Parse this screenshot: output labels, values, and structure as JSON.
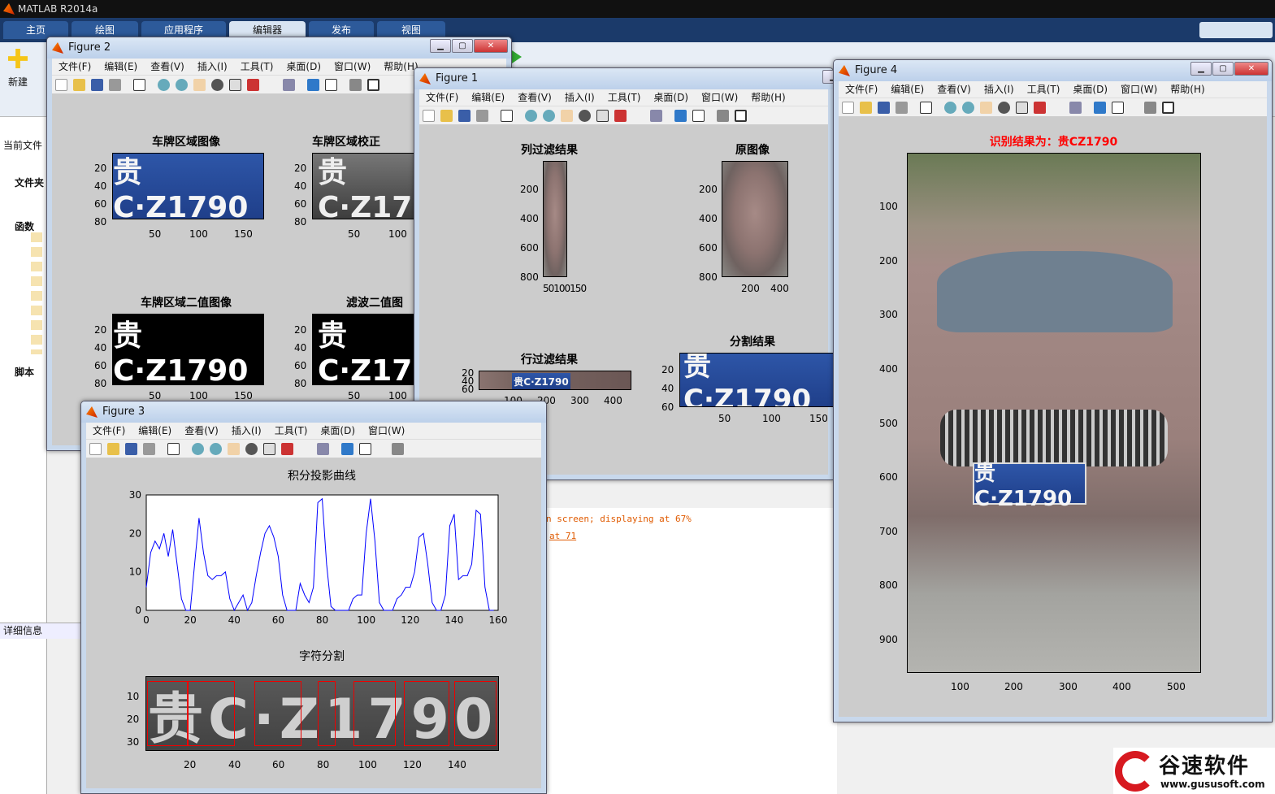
{
  "matlab": {
    "title": "MATLAB R2014a",
    "tabs": [
      "主页",
      "绘图",
      "应用程序",
      "编辑器",
      "发布",
      "视图"
    ],
    "new_label": "新建",
    "current_folder": "当前文件",
    "folder_header": "文件夹",
    "functions_header": "函数",
    "scripts_header": "脚本",
    "details": "详细信息",
    "cmd_lines": [
      "n screen; displaying at 67%",
      "at 71"
    ]
  },
  "menus": [
    "文件(F)",
    "编辑(E)",
    "查看(V)",
    "插入(I)",
    "工具(T)",
    "桌面(D)",
    "窗口(W)",
    "帮助(H)"
  ],
  "fig2": {
    "title": "Figure 2",
    "p1": {
      "title": "车牌区域图像",
      "yticks": [
        "20",
        "40",
        "60",
        "80"
      ],
      "xticks": [
        "50",
        "100",
        "150"
      ]
    },
    "p2": {
      "title": "车牌区域校正",
      "yticks": [
        "20",
        "40",
        "60",
        "80"
      ],
      "xticks": [
        "50",
        "100"
      ]
    },
    "p3": {
      "title": "车牌区域二值图像",
      "yticks": [
        "20",
        "40",
        "60",
        "80"
      ],
      "xticks": [
        "50",
        "100",
        "150"
      ]
    },
    "p4": {
      "title": "滤波二值图",
      "yticks": [
        "20",
        "40",
        "60",
        "80"
      ],
      "xticks": [
        "50",
        "100"
      ]
    }
  },
  "fig1": {
    "title": "Figure 1",
    "p1": {
      "title": "列过滤结果",
      "yticks": [
        "200",
        "400",
        "600",
        "800"
      ],
      "xticks": "50100150"
    },
    "p2": {
      "title": "原图像",
      "yticks": [
        "200",
        "400",
        "600",
        "800"
      ],
      "xticks": [
        "200",
        "400"
      ]
    },
    "p3": {
      "title": "行过滤结果",
      "yticks": [
        "20",
        "40",
        "60"
      ],
      "xticks": [
        "100",
        "200",
        "300",
        "400"
      ]
    },
    "p4": {
      "title": "分割结果",
      "yticks": [
        "20",
        "40",
        "60"
      ],
      "xticks": [
        "50",
        "100",
        "150"
      ]
    }
  },
  "fig3": {
    "title": "Figure 3",
    "chart_title": "积分投影曲线",
    "seg_title": "字符分割",
    "seg_yticks": [
      "10",
      "20",
      "30"
    ],
    "seg_xticks": [
      "20",
      "40",
      "60",
      "80",
      "100",
      "120",
      "140"
    ]
  },
  "fig4": {
    "title": "Figure 4",
    "result": "识别结果为：贵CZ1790",
    "yticks": [
      "100",
      "200",
      "300",
      "400",
      "500",
      "600",
      "700",
      "800",
      "900"
    ],
    "xticks": [
      "100",
      "200",
      "300",
      "400",
      "500"
    ]
  },
  "plate_text": "贵C·Z1790",
  "brand": {
    "name": "谷速软件",
    "url": "www.gususoft.com"
  },
  "chart_data": {
    "type": "line",
    "title": "积分投影曲线",
    "xlim": [
      0,
      160
    ],
    "ylim": [
      0,
      30
    ],
    "xticks": [
      0,
      20,
      40,
      60,
      80,
      100,
      120,
      140,
      160
    ],
    "yticks": [
      0,
      10,
      20,
      30
    ],
    "color": "#0000ff",
    "x": [
      0,
      2,
      4,
      6,
      8,
      10,
      12,
      14,
      16,
      18,
      20,
      22,
      24,
      26,
      28,
      30,
      32,
      34,
      36,
      38,
      40,
      42,
      44,
      46,
      48,
      50,
      52,
      54,
      56,
      58,
      60,
      62,
      64,
      66,
      68,
      70,
      72,
      74,
      76,
      78,
      80,
      82,
      84,
      86,
      88,
      90,
      92,
      94,
      96,
      98,
      100,
      102,
      104,
      106,
      108,
      110,
      112,
      114,
      116,
      118,
      120,
      122,
      124,
      126,
      128,
      130,
      132,
      134,
      136,
      138,
      140,
      142,
      144,
      146,
      148,
      150,
      152,
      154,
      156,
      158
    ],
    "values": [
      6,
      15,
      18,
      16,
      20,
      14,
      21,
      12,
      3,
      0,
      0,
      12,
      24,
      15,
      9,
      8,
      9,
      9,
      10,
      3,
      0,
      2,
      4,
      0,
      2,
      9,
      15,
      20,
      22,
      19,
      14,
      4,
      0,
      0,
      0,
      7,
      4,
      2,
      6,
      28,
      29,
      12,
      1,
      0,
      0,
      0,
      0,
      3,
      4,
      4,
      20,
      29,
      18,
      2,
      0,
      0,
      0,
      3,
      4,
      6,
      6,
      10,
      19,
      20,
      12,
      2,
      0,
      0,
      4,
      22,
      25,
      8,
      9,
      9,
      12,
      26,
      25,
      6,
      0,
      0
    ]
  }
}
